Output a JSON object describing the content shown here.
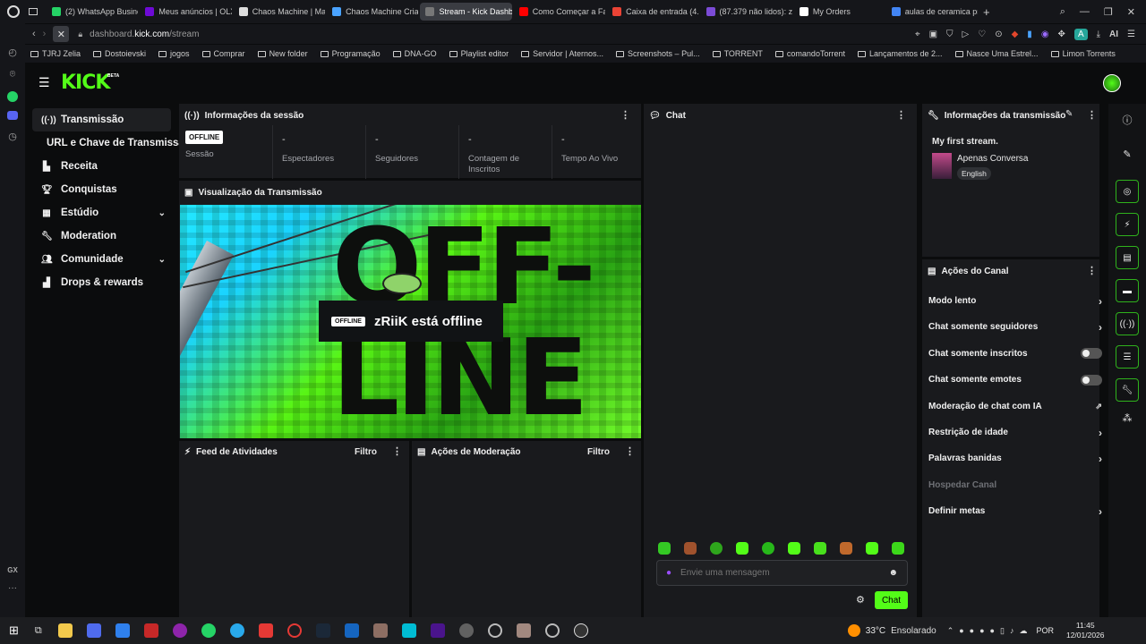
{
  "browser": {
    "tabs": [
      {
        "label": "(2) WhatsApp Busine",
        "color": "#25d366"
      },
      {
        "label": "Meus anúncios | OLX",
        "color": "#6e0ad6"
      },
      {
        "label": "Chaos Machine | Ma",
        "color": "#dddddd"
      },
      {
        "label": "Chaos Machine Cria",
        "color": "#4aa3ff"
      },
      {
        "label": "Stream - Kick Dashboard",
        "color": "#777777"
      },
      {
        "label": "Como Começar a Fa",
        "color": "#ff0000"
      },
      {
        "label": "Caixa de entrada (4.1",
        "color": "#ea4335"
      },
      {
        "label": "(87.379 não lidos): ze",
        "color": "#7b4bd6"
      },
      {
        "label": "My Orders",
        "color": "#ffffff"
      },
      {
        "label": "aulas de ceramica pr",
        "color": "#4285f4"
      }
    ],
    "url_domain": "dashboard.",
    "url_host": "kick.com",
    "url_path": "/stream",
    "bookmarks": [
      "TJRJ Zelia",
      "Dostoievski",
      "jogos",
      "Comprar",
      "New folder",
      "Programação",
      "DNA-GO",
      "Playlist editor",
      "Servidor | Aternos...",
      "Screenshots – Pul...",
      "TORRENT",
      "comandoTorrent",
      "Lançamentos de 2...",
      "Nasce Uma Estrel...",
      "Limon Torrents"
    ],
    "ai_label": "AI"
  },
  "kick": {
    "logo": "KICK",
    "beta": "BETA",
    "accent": "#53fc18",
    "nav": [
      {
        "label": "Transmissão",
        "icon": "broadcast-icon"
      },
      {
        "label": "URL e Chave de Transmissão",
        "icon": ""
      },
      {
        "label": "Receita",
        "icon": "chart-icon"
      },
      {
        "label": "Conquistas",
        "icon": "trophy-icon"
      },
      {
        "label": "Estúdio",
        "icon": "grid-icon"
      },
      {
        "label": "Moderation",
        "icon": "wrench-icon"
      },
      {
        "label": "Comunidade",
        "icon": "people-icon"
      },
      {
        "label": "Drops & rewards",
        "icon": "gift-icon"
      }
    ],
    "session": {
      "title": "Informações da sessão",
      "badge": "OFFLINE",
      "stats": [
        {
          "value": "",
          "label": "Sessão"
        },
        {
          "value": "-",
          "label": "Espectadores"
        },
        {
          "value": "-",
          "label": "Seguidores"
        },
        {
          "value": "-",
          "label": "Contagem de Inscritos"
        },
        {
          "value": "-",
          "label": "Tempo Ao Vivo"
        }
      ]
    },
    "preview": {
      "title": "Visualização da Transmissão",
      "badge": "OFFLINE",
      "message": "zRiiK está offline",
      "big_text_1": "OFF-",
      "big_text_2": "LINE"
    },
    "feed": {
      "title": "Feed de Atividades",
      "filter": "Filtro"
    },
    "modactions": {
      "title": "Ações de Moderação",
      "filter": "Filtro"
    },
    "chat": {
      "title": "Chat",
      "placeholder": "Envie uma mensagem",
      "send": "Chat"
    },
    "stream_info": {
      "title": "Informações da transmissão",
      "stream_title": "My first stream.",
      "category": "Apenas Conversa",
      "language": "English"
    },
    "channel_actions": {
      "title": "Ações do Canal",
      "items": [
        {
          "label": "Modo lento",
          "control": "chevron"
        },
        {
          "label": "Chat somente seguidores",
          "control": "chevron"
        },
        {
          "label": "Chat somente inscritos",
          "control": "toggle"
        },
        {
          "label": "Chat somente emotes",
          "control": "toggle"
        },
        {
          "label": "Moderação de chat com IA",
          "control": "external"
        },
        {
          "label": "Restrição de idade",
          "control": "chevron"
        },
        {
          "label": "Palavras banidas",
          "control": "chevron"
        },
        {
          "label": "Hospedar Canal",
          "control": "disabled"
        },
        {
          "label": "Definir metas",
          "control": "chevron"
        }
      ]
    }
  },
  "taskbar": {
    "weather": "33°C",
    "weather_desc": "Ensolarado",
    "lang": "POR",
    "time": "11:45",
    "date": "12/01/2026"
  }
}
